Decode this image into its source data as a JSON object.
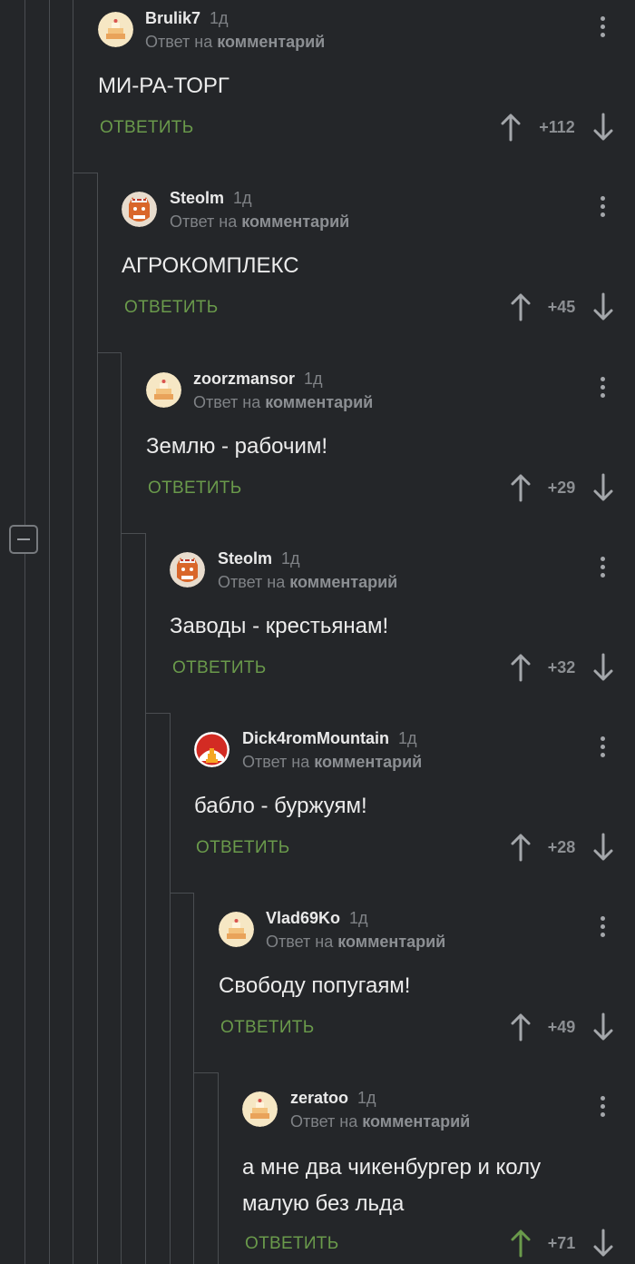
{
  "ui": {
    "reply_prefix": "Ответ на",
    "reply_target": "комментарий",
    "reply_button": "ОТВЕТИТЬ"
  },
  "colors": {
    "background": "#242629",
    "reply_button": "#6a9a4b",
    "vote_active": "#6a9a4b"
  },
  "comments": [
    {
      "username": "Brulik7",
      "age": "1д",
      "text": "МИ-РА-ТОРГ",
      "rating": "+112",
      "avatar": "default-cake-avatar-icon"
    },
    {
      "username": "Steolm",
      "age": "1д",
      "text": "АГРОКОМПЛЕКС",
      "rating": "+45",
      "avatar": "tiger-avatar-icon"
    },
    {
      "username": "zoorzmansor",
      "age": "1д",
      "text": "Землю - рабочим!",
      "rating": "+29",
      "avatar": "default-cake-avatar-icon"
    },
    {
      "username": "Steolm",
      "age": "1д",
      "text": "Заводы - крестьянам!",
      "rating": "+32",
      "avatar": "tiger-avatar-icon"
    },
    {
      "username": "Dick4romMountain",
      "age": "1д",
      "text": "бабло - буржуям!",
      "rating": "+28",
      "avatar": "temple-avatar-icon"
    },
    {
      "username": "Vlad69Ko",
      "age": "1д",
      "text": "Свободу попугаям!",
      "rating": "+49",
      "avatar": "default-cake-avatar-icon"
    },
    {
      "username": "zeratoo",
      "age": "1д",
      "text_lines": [
        "а мне два чикенбургер и колу",
        "малую без льда"
      ],
      "rating": "+71",
      "upvoted": true,
      "avatar": "default-cake-avatar-icon"
    }
  ]
}
